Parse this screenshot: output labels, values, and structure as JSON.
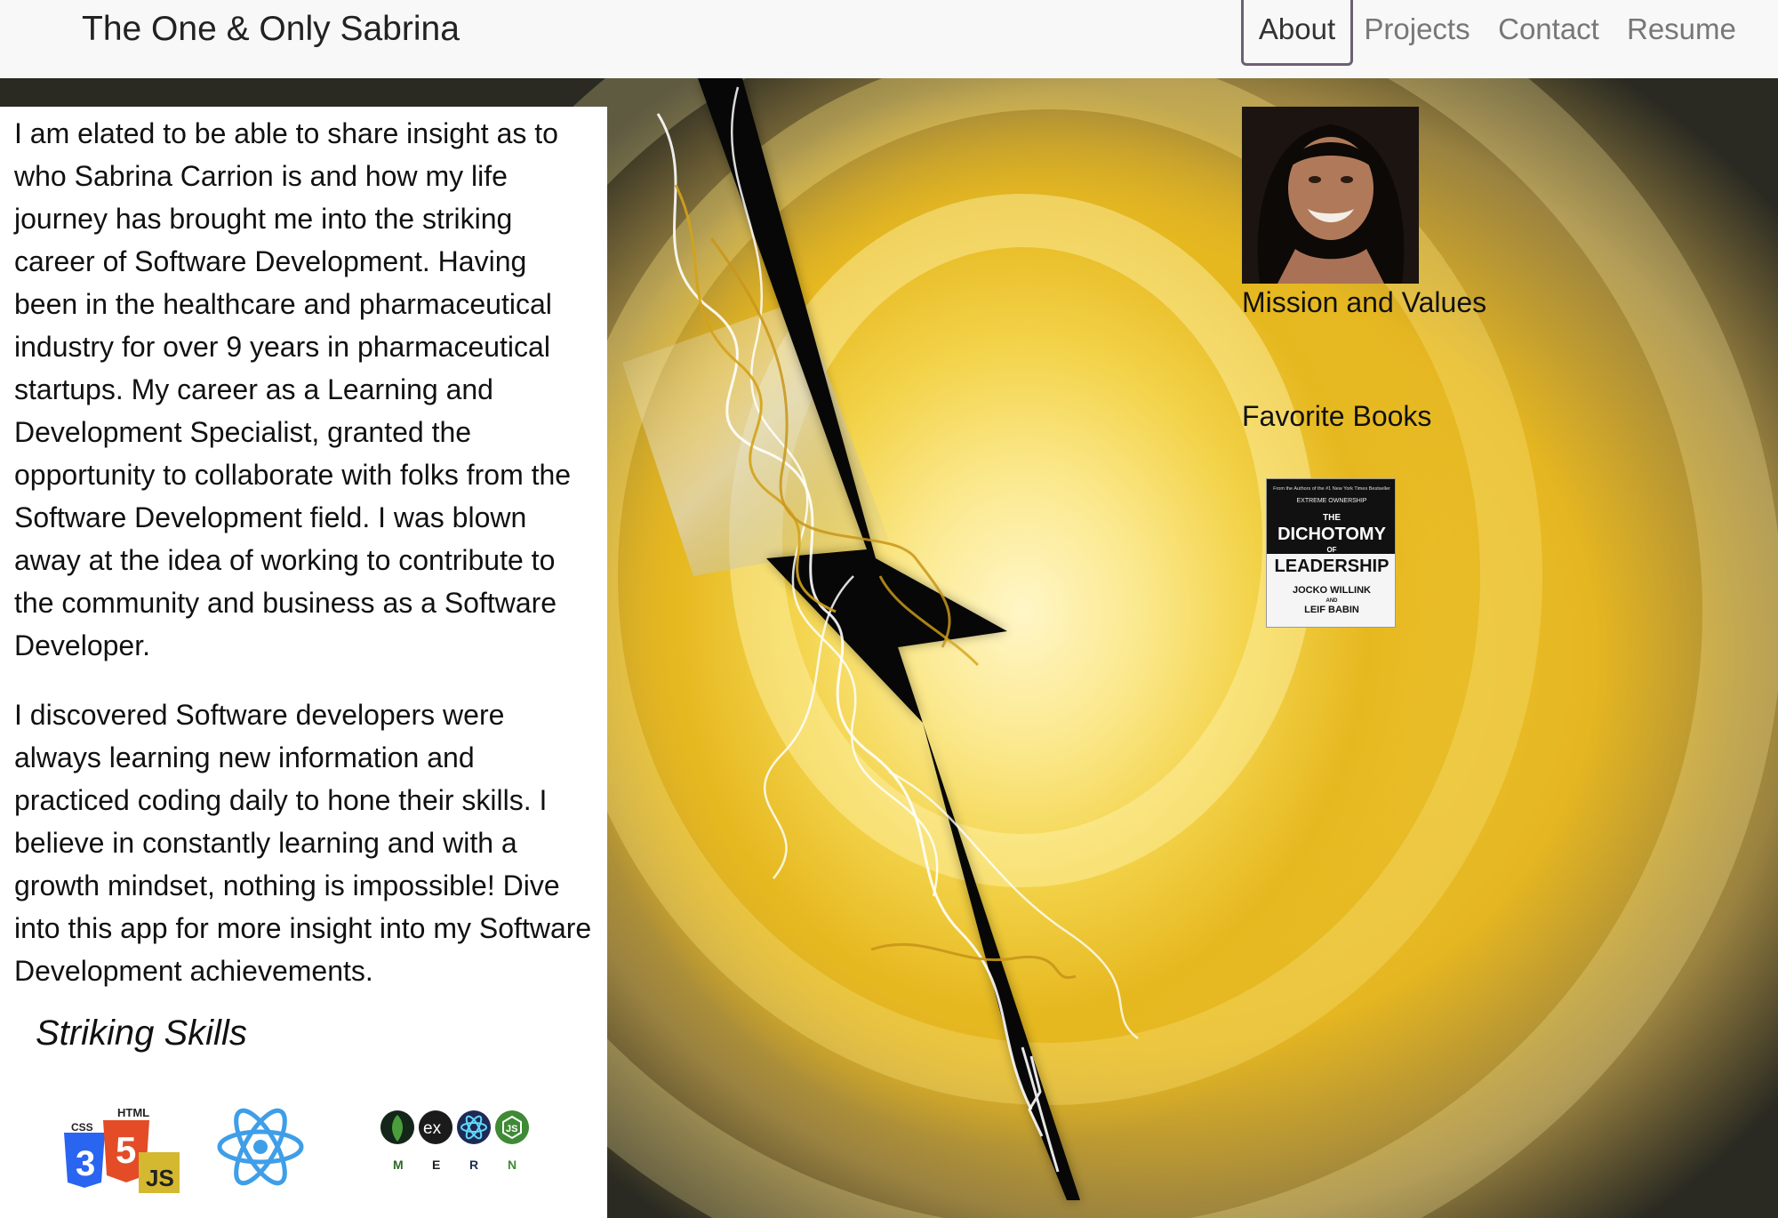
{
  "navbar": {
    "brand": "The One & Only Sabrina",
    "links": [
      {
        "label": "About",
        "active": true
      },
      {
        "label": "Projects",
        "active": false
      },
      {
        "label": "Contact",
        "active": false
      },
      {
        "label": "Resume",
        "active": false
      }
    ]
  },
  "about": {
    "paragraphs": [
      "I am elated to be able to share insight as to who Sabrina Carrion is and how my life journey has brought me into the striking career of Software Development. Having been in the healthcare and pharmaceutical industry for over 9 years in pharmaceutical startups. My career as a Learning and Development Specialist, granted the opportunity to collaborate with folks from the Software Development field. I was blown away at the idea of working to contribute to the community and business as a Software Developer.",
      "I discovered Software developers were always learning new information and practiced coding daily to hone their skills. I believe in constantly learning and with a growth mindset, nothing is impossible! Dive into this app for more insight into my Software Development achievements."
    ],
    "skills_title": "Striking Skills",
    "skills": [
      {
        "icon": "html-css-js-icon",
        "labels": [
          "HTML",
          "CSS",
          "JS"
        ]
      },
      {
        "icon": "react-icon"
      },
      {
        "icon": "mern-icon",
        "letters": [
          "M",
          "E",
          "R",
          "N"
        ],
        "express_label": "ex"
      }
    ]
  },
  "sidebar": {
    "mission_label": "Mission and Values",
    "books_label": "Favorite Books",
    "book": {
      "top_text": "From the Authors of the #1 New York Times Bestseller",
      "series": "EXTREME OWNERSHIP",
      "title_1": "THE",
      "title_2": "DICHOTOMY",
      "title_3": "OF",
      "title_4": "LEADERSHIP",
      "author_1": "JOCKO WILLINK",
      "author_and": "AND",
      "author_2": "LEIF BABIN"
    }
  },
  "colors": {
    "accent_yellow": "#f2cf3a",
    "nav_active_border": "#6d5f74",
    "text": "#111111"
  }
}
